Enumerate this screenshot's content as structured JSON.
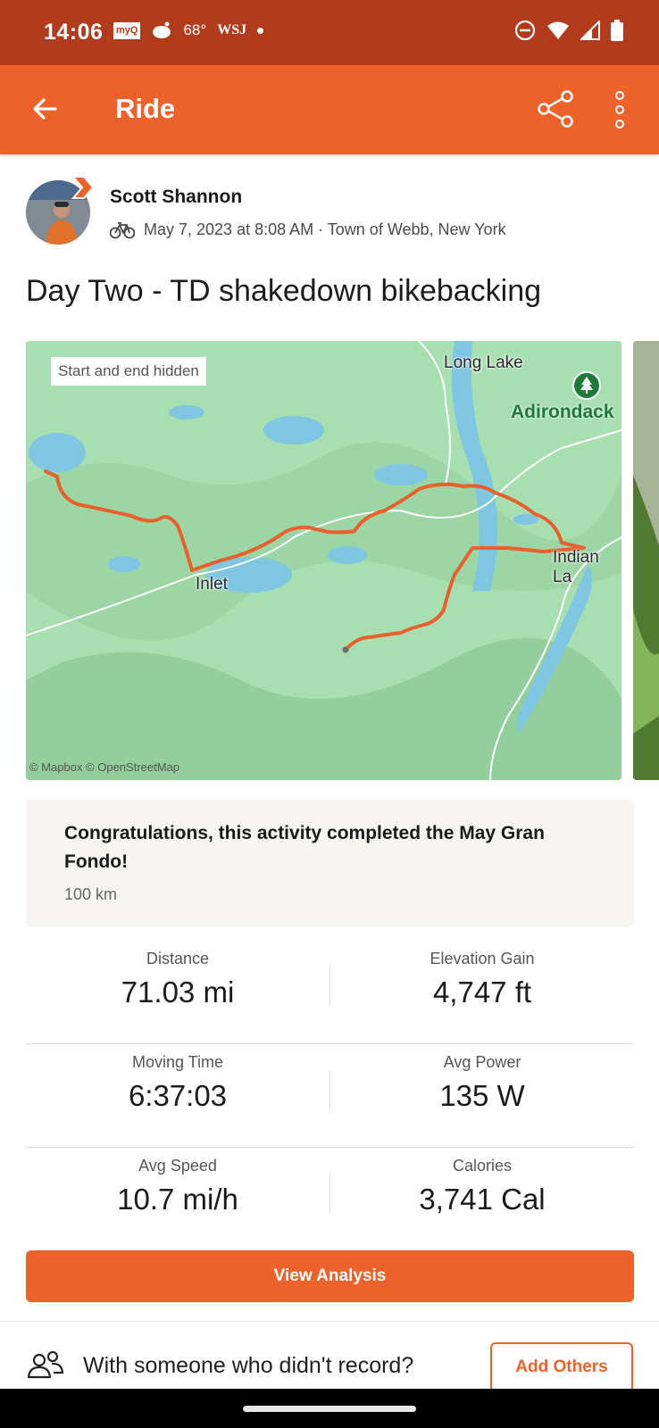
{
  "status_bar": {
    "time": "14:06",
    "temperature": "68°",
    "wsj": "WSJ",
    "myq": "myQ"
  },
  "app_bar": {
    "title": "Ride"
  },
  "athlete": {
    "name": "Scott Shannon",
    "date": "May 7, 2023 at 8:08 AM · Town of Webb, New York"
  },
  "activity": {
    "title": "Day Two - TD shakedown bikebacking"
  },
  "map": {
    "chip": "Start and end hidden",
    "labels": {
      "long_lake": "Long Lake",
      "adirondack": "Adirondack",
      "inlet": "Inlet",
      "indian_lake": "Indian La"
    },
    "credit": "© Mapbox © OpenStreetMap",
    "route_color": "#e8602c"
  },
  "challenge": {
    "title": "Congratulations, this activity completed the May Gran Fondo!",
    "subtitle": "100 km"
  },
  "stats": [
    {
      "left": {
        "label": "Distance",
        "value": "71.03 mi"
      },
      "right": {
        "label": "Elevation Gain",
        "value": "4,747 ft"
      }
    },
    {
      "left": {
        "label": "Moving Time",
        "value": "6:37:03"
      },
      "right": {
        "label": "Avg Power",
        "value": "135 W"
      }
    },
    {
      "left": {
        "label": "Avg Speed",
        "value": "10.7 mi/h"
      },
      "right": {
        "label": "Calories",
        "value": "3,741 Cal"
      }
    }
  ],
  "actions": {
    "view_analysis": "View Analysis",
    "with_someone": "With someone who didn't record?",
    "add_others": "Add Others"
  },
  "colors": {
    "brand": "#ec622a",
    "status_bar": "#b23b1b"
  }
}
